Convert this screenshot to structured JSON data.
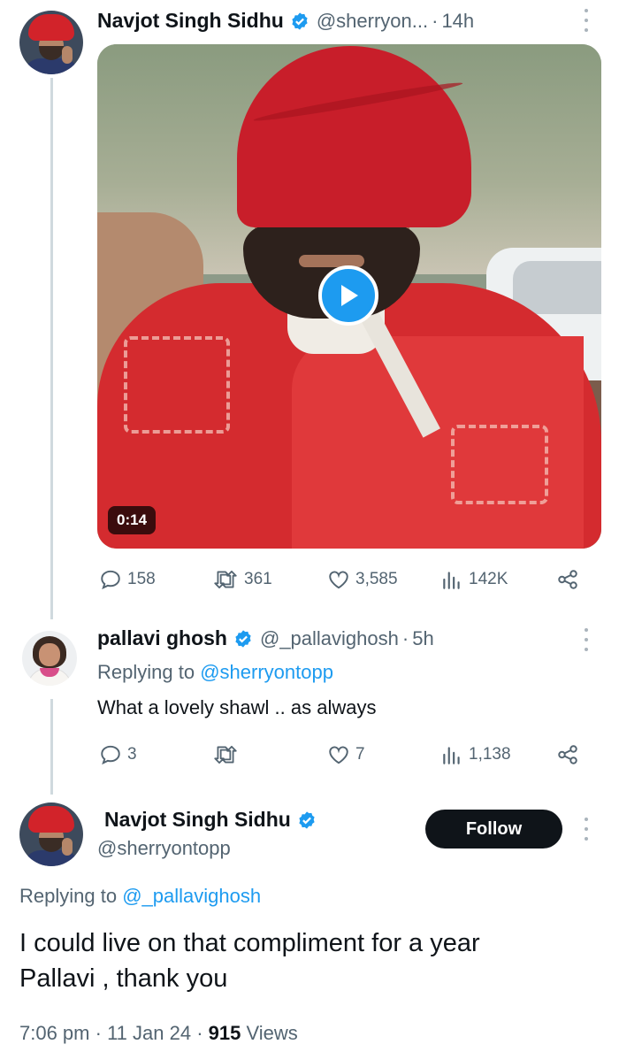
{
  "tweet1": {
    "author_name": "Navjot Singh Sidhu",
    "handle": "@sherryon...",
    "time": "14h",
    "video_duration": "0:14",
    "stats": {
      "replies": "158",
      "retweets": "361",
      "likes": "3,585",
      "views": "142K"
    }
  },
  "reply1": {
    "author_name": "pallavi ghosh",
    "handle": "@_pallavighosh",
    "time": "5h",
    "replying_prefix": "Replying to ",
    "replying_to": "@sherryontopp",
    "text": "What a lovely shawl .. as always",
    "stats": {
      "replies": "3",
      "retweets": "",
      "likes": "7",
      "views": "1,138"
    }
  },
  "reply2": {
    "author_name": "Navjot Singh Sidhu",
    "handle": "@sherryontopp",
    "follow_label": "Follow",
    "replying_prefix": "Replying to ",
    "replying_to": "@_pallavighosh",
    "text_line1": "I could live on that compliment for a year",
    "text_line2": "Pallavi , thank you",
    "time": "7:06 pm",
    "date": "11 Jan 24",
    "views_count": "915",
    "views_label": " Views"
  },
  "colors": {
    "accent": "#1d9bf0",
    "text": "#0f1419",
    "muted": "#536471",
    "turban_red": "#c81e2a"
  }
}
